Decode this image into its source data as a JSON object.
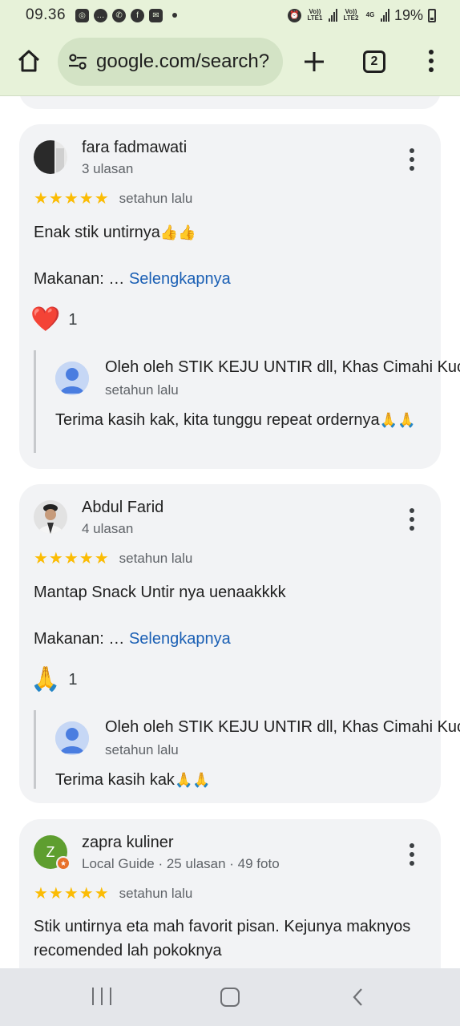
{
  "status_bar": {
    "time": "09.36",
    "network1": "Vo)) LTE1",
    "network2": "Vo)) LTE2",
    "network_type": "4G",
    "battery": "19%"
  },
  "browser": {
    "url": "google.com/search?",
    "tab_count": "2",
    "icons": [
      "home-icon",
      "tune-icon",
      "plus-icon",
      "tabs-icon",
      "menu-icon"
    ]
  },
  "reviews": [
    {
      "name": "fara fadmawati",
      "meta": "3 ulasan",
      "stars": "★★★★★",
      "rating": 5,
      "date": "setahun lalu",
      "text": "Enak stik untirnya",
      "text_emoji": "👍👍",
      "detail_prefix": "Makanan: …",
      "detail_link": "Selengkapnya",
      "reaction_emoji": "❤️",
      "reaction_count": "1",
      "reply": {
        "owner": "Oleh oleh STIK KEJU UNTIR dll, Khas Cimahi Kuc",
        "date": "setahun lalu",
        "text": "Terima kasih kak, kita tunggu repeat ordernya",
        "emoji": "🙏🙏"
      }
    },
    {
      "name": "Abdul Farid",
      "meta": "4 ulasan",
      "stars": "★★★★★",
      "rating": 5,
      "date": "setahun lalu",
      "text": "Mantap Snack Untir nya uenaakkkk",
      "detail_prefix": "Makanan: …",
      "detail_link": "Selengkapnya",
      "reaction_emoji": "🙏",
      "reaction_count": "1",
      "reply": {
        "owner": "Oleh oleh STIK KEJU UNTIR dll, Khas Cimahi Kuc",
        "date": "setahun lalu",
        "text": "Terima kasih kak",
        "emoji": "🙏🙏"
      }
    },
    {
      "name": "zapra kuliner",
      "avatar_letter": "Z",
      "meta": "Local Guide · 25 ulasan · 49 foto",
      "stars": "★★★★★",
      "rating": 5,
      "date": "setahun lalu",
      "text": "Stik untirnya eta mah favorit pisan. Kejunya maknyos recomended lah pokoknya"
    }
  ],
  "colors": {
    "chrome_bg": "#e7f2d9",
    "url_pill": "#d3e3c5",
    "card_bg": "#f2f3f5",
    "star": "#fbbc04",
    "link": "#1a5fb4",
    "zapra_avatar": "#5e9e2f"
  }
}
